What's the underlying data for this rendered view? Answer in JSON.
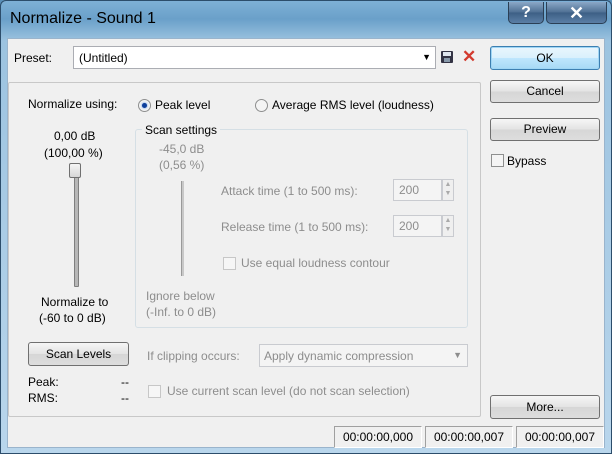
{
  "window": {
    "title": "Normalize - Sound 1",
    "help_glyph": "?",
    "close_glyph": "✕"
  },
  "preset": {
    "label": "Preset:",
    "value": "(Untitled)",
    "dropdown_glyph": "▼",
    "save_glyph": "💾",
    "delete_glyph": "✕"
  },
  "buttons": {
    "ok": "OK",
    "cancel": "Cancel",
    "preview": "Preview",
    "more": "More...",
    "scan_levels": "Scan Levels"
  },
  "bypass": {
    "label": "Bypass",
    "checked": false
  },
  "normalize": {
    "label": "Normalize using:",
    "options": [
      {
        "label": "Peak level",
        "selected": true
      },
      {
        "label": "Average RMS level (loudness)",
        "selected": false
      }
    ],
    "level_db": "0,00 dB",
    "level_pct": "(100,00 %)",
    "slider_value_db": 0,
    "to_label": "Normalize to",
    "to_range": "(-60 to 0 dB)"
  },
  "scan": {
    "title": "Scan settings",
    "level_db": "-45,0 dB",
    "level_pct": "(0,56 %)",
    "attack_label": "Attack time (1 to 500 ms):",
    "attack_value": "200",
    "release_label": "Release time (1 to 500 ms):",
    "release_value": "200",
    "equal_loudness_label": "Use equal loudness contour",
    "ignore_label": "Ignore below",
    "ignore_range": "(-Inf. to 0 dB)"
  },
  "clipping": {
    "label": "If clipping occurs:",
    "value": "Apply dynamic compression",
    "dropdown_glyph": "▼"
  },
  "use_current_scan": "Use current scan level (do not scan selection)",
  "stats": {
    "peak_label": "Peak:",
    "peak_value": "--",
    "rms_label": "RMS:",
    "rms_value": "--"
  },
  "status": [
    "00:00:00,000",
    "00:00:00,007",
    "00:00:00,007"
  ],
  "colors": {
    "accent": "#3c7fb1",
    "disabled_text": "#8d8d8d",
    "delete_red": "#d23a2e"
  }
}
